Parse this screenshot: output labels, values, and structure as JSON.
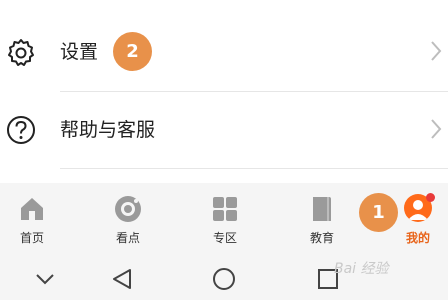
{
  "menu": {
    "items": [
      {
        "label": "设置",
        "icon": "gear-icon"
      },
      {
        "label": "帮助与客服",
        "icon": "help-circle-icon"
      }
    ]
  },
  "annotations": {
    "step1": "1",
    "step2": "2",
    "color": "#e8914a"
  },
  "tabbar": {
    "tabs": [
      {
        "label": "首页",
        "icon": "home-icon"
      },
      {
        "label": "看点",
        "icon": "watch-icon"
      },
      {
        "label": "专区",
        "icon": "grid-icon"
      },
      {
        "label": "教育",
        "icon": "book-icon"
      },
      {
        "label": "我的",
        "icon": "avatar-icon",
        "active": true
      }
    ],
    "active_color": "#e8641a",
    "notification_dot_color": "#e83a3a"
  },
  "navbar": {
    "buttons": [
      "chevron-down-icon",
      "back-triangle-icon",
      "home-circle-icon",
      "recent-square-icon"
    ]
  },
  "watermark": {
    "text": "Bai 经验"
  }
}
